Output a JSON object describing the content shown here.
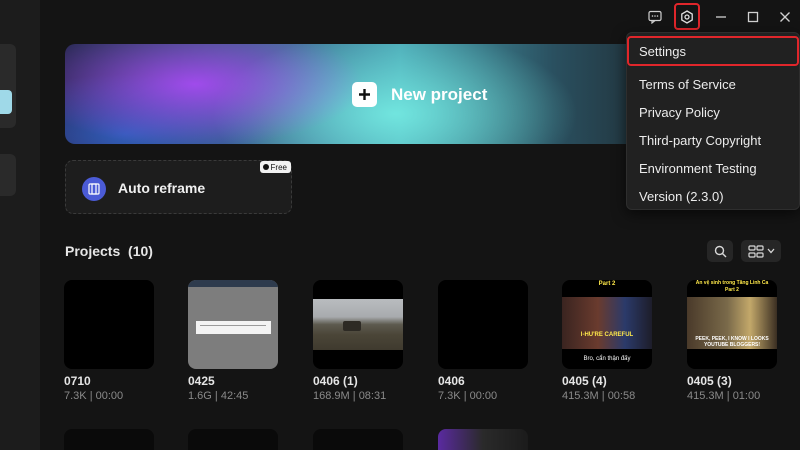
{
  "titlebar": {
    "icons": [
      "feedback-icon",
      "settings-icon",
      "minimize-icon",
      "maximize-icon",
      "close-icon"
    ]
  },
  "banner": {
    "label": "New project"
  },
  "auto_reframe": {
    "label": "Auto reframe",
    "badge": "Free"
  },
  "projects": {
    "title": "Projects",
    "count": "(10)",
    "items": [
      {
        "name": "0710",
        "size": "7.3K",
        "duration": "00:00"
      },
      {
        "name": "0425",
        "size": "1.6G",
        "duration": "42:45"
      },
      {
        "name": "0406 (1)",
        "size": "168.9M",
        "duration": "08:31"
      },
      {
        "name": "0406",
        "size": "7.3K",
        "duration": "00:00"
      },
      {
        "name": "0405 (4)",
        "size": "415.3M",
        "duration": "00:58"
      },
      {
        "name": "0405 (3)",
        "size": "415.3M",
        "duration": "01:00"
      }
    ]
  },
  "thumbnails": {
    "t5_top": "Part 2",
    "t5_sub": "I-HU'RE CAREFUL",
    "t5_cap": "Bro, cẩn thận đấy",
    "t6_top": "Ăn vệ sinh trong Tăng Linh Ca",
    "t6_top2": "Part 2",
    "t6_sub": "PEEK, PEEK, I KNOW I LOOKS YOUTUBE BLOGGERS!"
  },
  "menu": {
    "items": [
      "Settings",
      "Terms of Service",
      "Privacy Policy",
      "Third-party Copyright",
      "Environment Testing",
      "Version (2.3.0)"
    ]
  },
  "colors": {
    "highlight": "#e0262b",
    "accent_blue": "#4b5bd6"
  }
}
